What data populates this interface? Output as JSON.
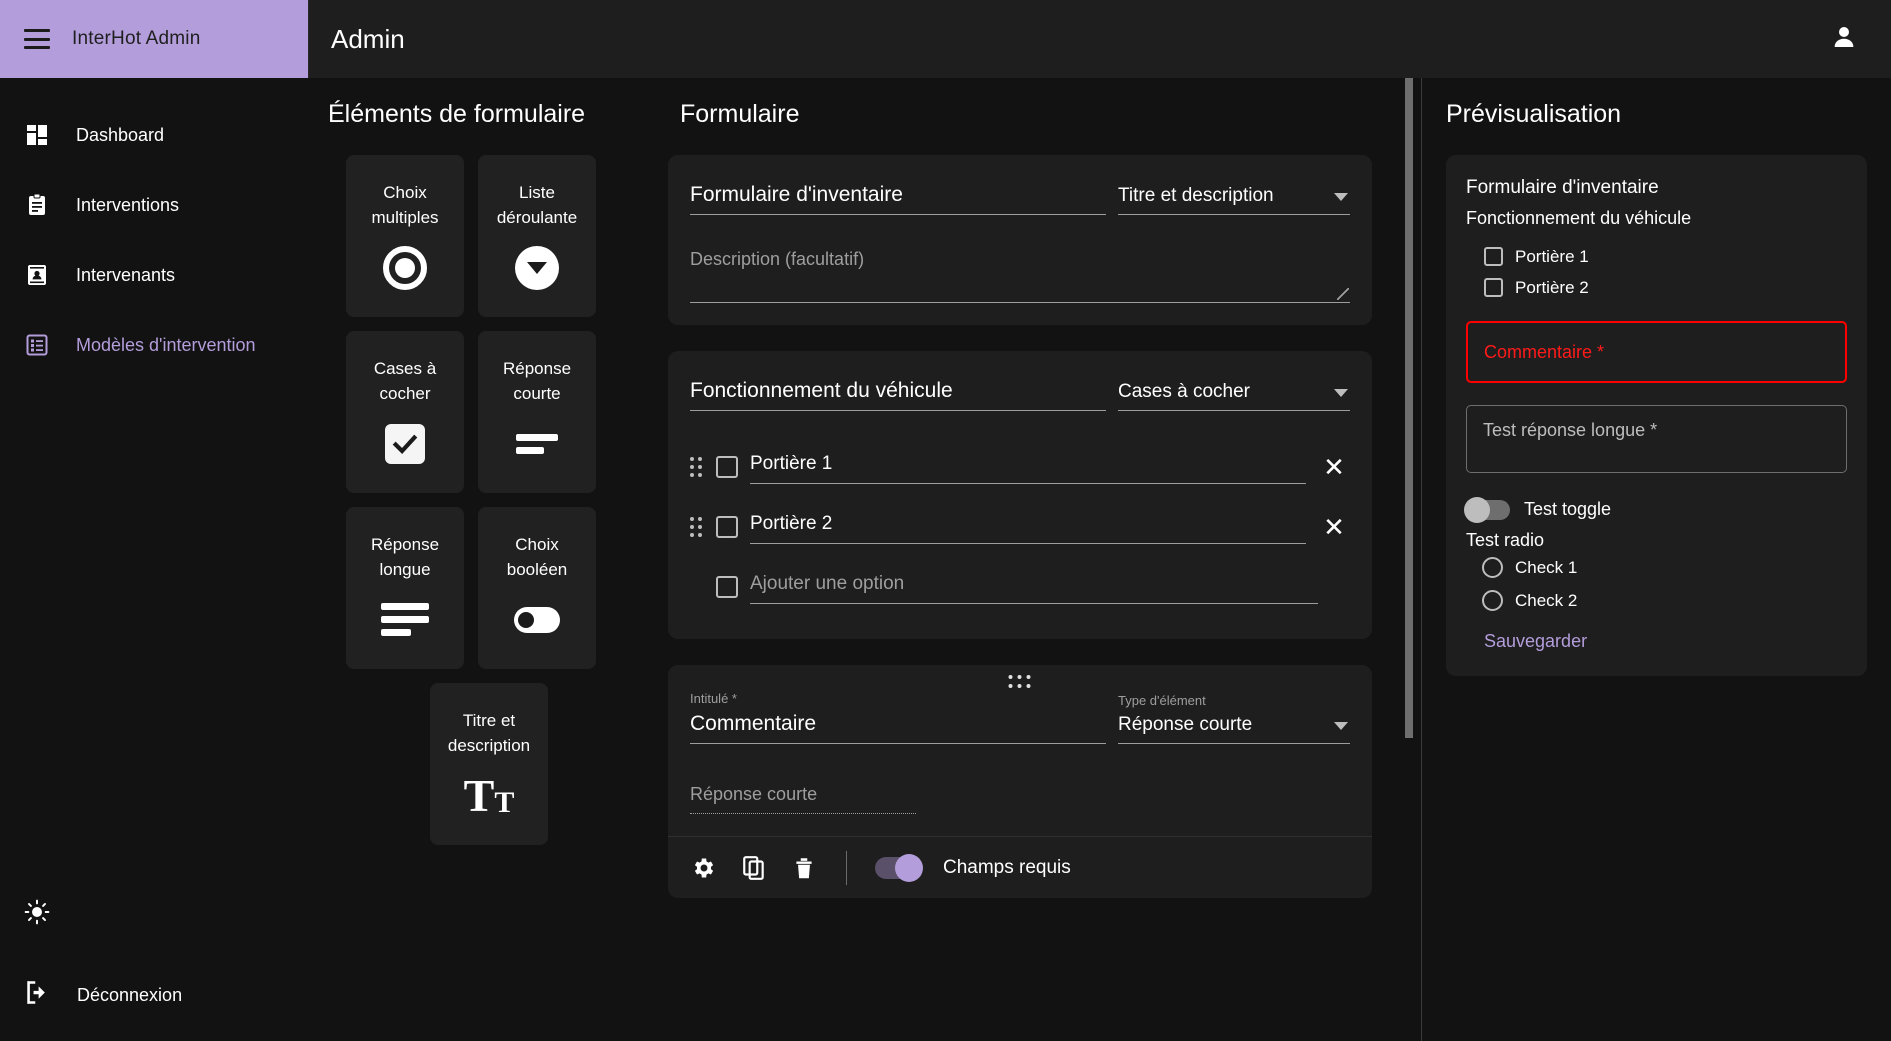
{
  "sidebar": {
    "brand": "InterHot Admin",
    "menu_icon": "hamburger-menu-icon",
    "items": [
      {
        "label": "Dashboard",
        "icon": "dashboard-icon",
        "active": false
      },
      {
        "label": "Interventions",
        "icon": "clipboard-icon",
        "active": false
      },
      {
        "label": "Intervenants",
        "icon": "contact-card-icon",
        "active": false
      },
      {
        "label": "Modèles d'intervention",
        "icon": "list-box-icon",
        "active": true
      }
    ],
    "theme_icon": "brightness-sun-icon",
    "logout": {
      "label": "Déconnexion",
      "icon": "logout-icon"
    }
  },
  "topbar": {
    "title": "Admin",
    "account_icon": "person-icon"
  },
  "palette": {
    "title": "Éléments de formulaire",
    "cards": [
      {
        "label": "Choix multiples",
        "icon": "radio-button-icon"
      },
      {
        "label": "Liste déroulante",
        "icon": "dropdown-icon"
      },
      {
        "label": "Cases à cocher",
        "icon": "checkbox-checked-icon"
      },
      {
        "label": "Réponse courte",
        "icon": "short-text-icon"
      },
      {
        "label": "Réponse longue",
        "icon": "long-text-icon"
      },
      {
        "label": "Choix booléen",
        "icon": "toggle-icon"
      },
      {
        "label": "Titre et description",
        "icon": "title-text-icon"
      }
    ]
  },
  "form": {
    "title": "Formulaire",
    "cards": [
      {
        "kind": "title-description",
        "title_value": "Formulaire d'inventaire",
        "type_value": "Titre et description",
        "description_placeholder": "Description (facultatif)"
      },
      {
        "kind": "checkboxes",
        "title_value": "Fonctionnement du véhicule",
        "type_value": "Cases à cocher",
        "options": [
          {
            "value": "Portière 1",
            "remove_icon": "close-icon",
            "drag_icon": "drag-handle-icon"
          },
          {
            "value": "Portière 2",
            "remove_icon": "close-icon",
            "drag_icon": "drag-handle-icon"
          }
        ],
        "add_option_placeholder": "Ajouter une option"
      },
      {
        "kind": "short-answer",
        "label_caption": "Intitulé *",
        "title_value": "Commentaire",
        "type_caption": "Type d'élément",
        "type_value": "Réponse courte",
        "answer_placeholder": "Réponse courte",
        "footer": {
          "settings_icon": "gear-icon",
          "duplicate_icon": "copy-icon",
          "delete_icon": "trash-icon",
          "required_toggle_label": "Champs requis",
          "required_toggle_on": true
        }
      }
    ]
  },
  "preview": {
    "title": "Prévisualisation",
    "form_title": "Formulaire d'inventaire",
    "section_title": "Fonctionnement du véhicule",
    "checkboxes": [
      {
        "label": "Portière 1"
      },
      {
        "label": "Portière 2"
      }
    ],
    "error_field_label": "Commentaire *",
    "long_field_placeholder": "Test réponse longue *",
    "toggle_label": "Test toggle",
    "radio_group_label": "Test radio",
    "radios": [
      {
        "label": "Check 1"
      },
      {
        "label": "Check 2"
      }
    ],
    "save_label": "Sauvegarder"
  },
  "colors": {
    "accent": "#b39ddb",
    "error": "#ff0000",
    "panel": "#1e1e1e",
    "background": "#121212"
  }
}
